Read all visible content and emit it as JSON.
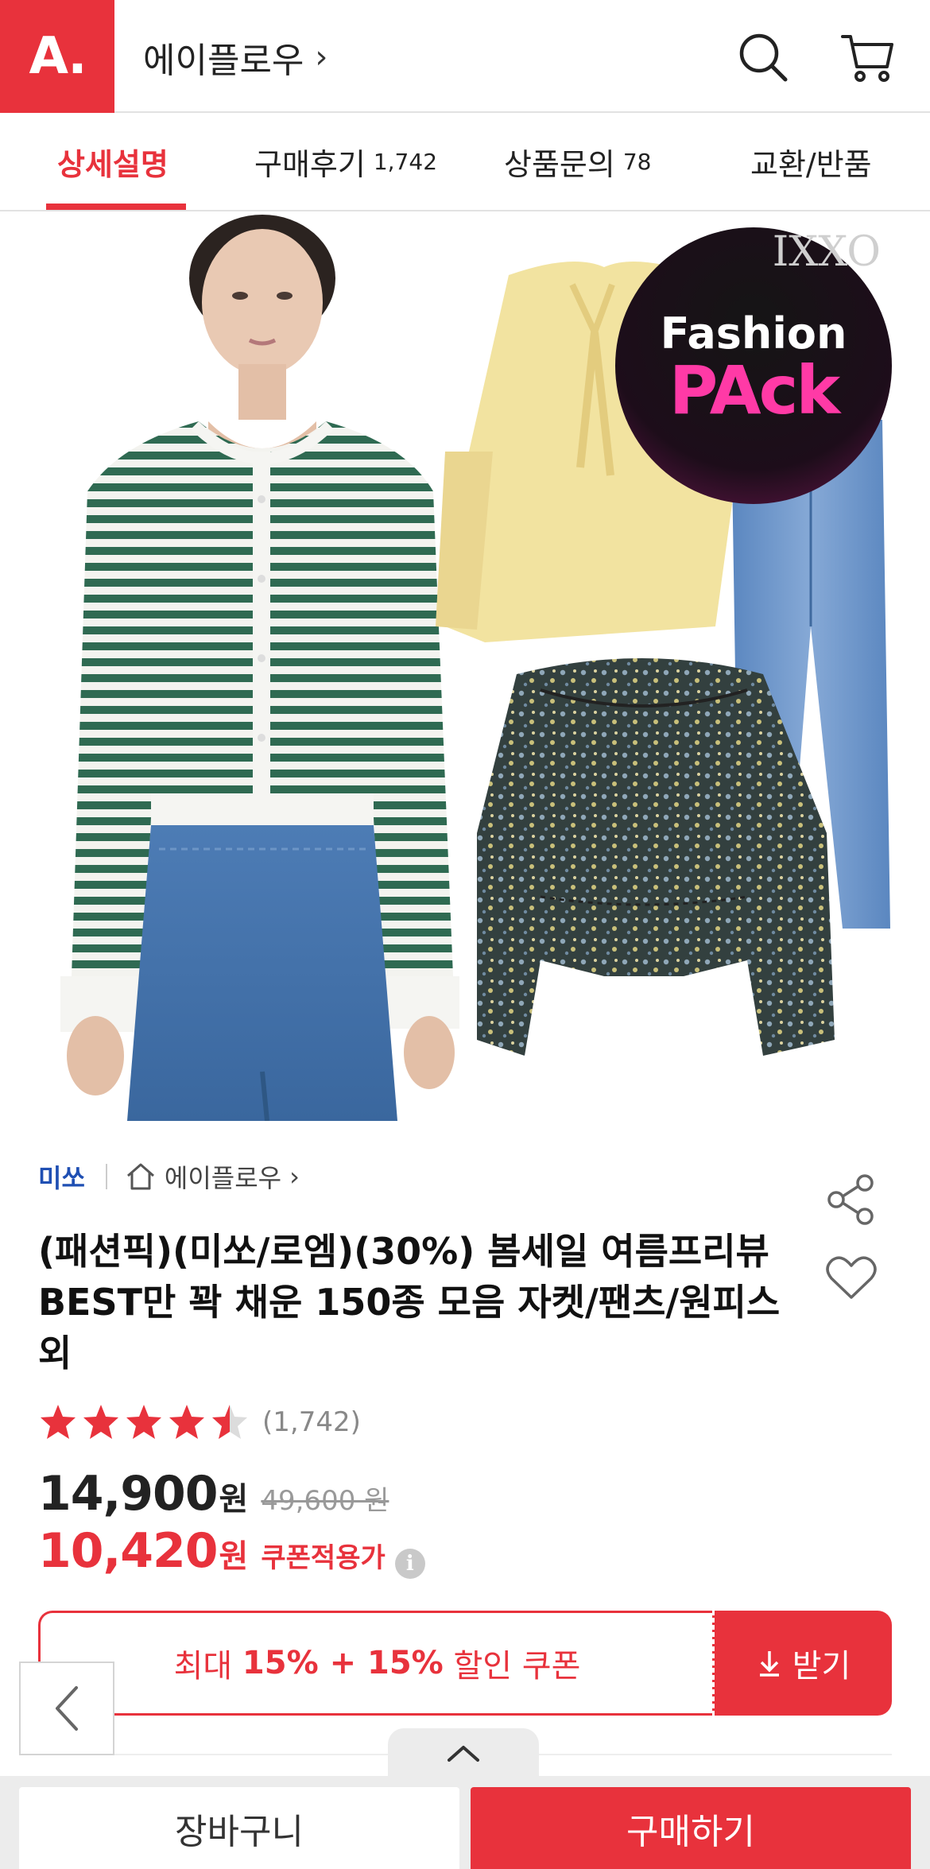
{
  "header": {
    "logo_text": "A.",
    "store_title": "에이플로우",
    "chevron": "›",
    "icons": [
      "search-icon",
      "cart-icon"
    ]
  },
  "tabs": [
    {
      "label": "상세설명",
      "count": "",
      "active": true
    },
    {
      "label": "구매후기",
      "count": "1,742",
      "active": false
    },
    {
      "label": "상품문의",
      "count": "78",
      "active": false
    },
    {
      "label": "교환/반품",
      "count": "",
      "active": false
    }
  ],
  "hero": {
    "badge_line1": "Fashion",
    "badge_line2": "PAck",
    "corner_text": "IXXO"
  },
  "product": {
    "brand": "미쏘",
    "store_link": "에이플로우",
    "title": "(패션픽)(미쏘/로엠)(30%) 봄세일 여름프리뷰 BEST만 꽉 채운 150종 모음 자켓/팬츠/원피스 외",
    "rating": 4.5,
    "review_count": "(1,742)",
    "price": "14,900",
    "price_unit": "원",
    "original_price": "49,600 원",
    "coupon_price": "10,420",
    "coupon_price_unit": "원",
    "coupon_price_label": "쿠폰적용가",
    "info_glyph": "i"
  },
  "coupon": {
    "prefix": "최대 ",
    "amount": "15% + 15%",
    "suffix": " 할인 쿠폰",
    "button_label": "받기"
  },
  "bottom_bar": {
    "cart_label": "장바구니",
    "buy_label": "구매하기"
  },
  "colors": {
    "accent": "#e8323c",
    "brand_link": "#1f4fb3",
    "star": "#e8323c"
  }
}
